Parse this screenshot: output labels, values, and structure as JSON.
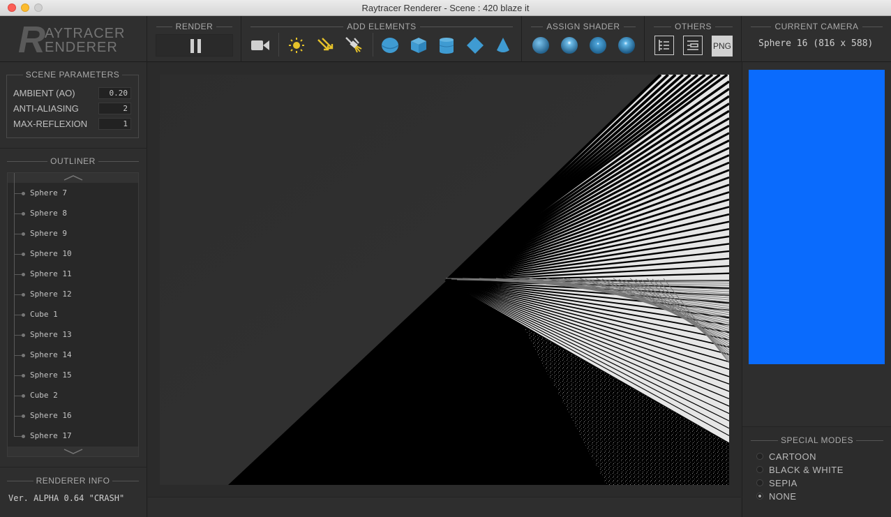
{
  "window": {
    "title": "Raytracer Renderer - Scene : 420 blaze it"
  },
  "logo": {
    "letter": "R",
    "line1": "AYTRACER",
    "line2": "ENDERER"
  },
  "toolbar": {
    "render_title": "RENDER",
    "add_title": "ADD ELEMENTS",
    "shader_title": "ASSIGN SHADER",
    "others_title": "OTHERS",
    "png_label": "PNG",
    "camera_title": "CURRENT CAMERA",
    "camera_value": "Sphere 16 (816 x 588)",
    "icons": [
      "pause-icon",
      "camera-icon",
      "point-light-icon",
      "directional-light-icon",
      "spot-light-icon",
      "sphere-icon",
      "cube-icon",
      "cylinder-icon",
      "plane-icon",
      "cone-icon",
      "shader-1-icon",
      "shader-2-icon",
      "shader-3-icon",
      "shader-4-icon",
      "list-icon",
      "properties-icon"
    ]
  },
  "scene": {
    "title": "SCENE PARAMETERS",
    "params": [
      {
        "label": "AMBIENT (AO)",
        "value": "0.20"
      },
      {
        "label": "ANTI-ALIASING",
        "value": "2"
      },
      {
        "label": "MAX-REFLEXION",
        "value": "1"
      }
    ]
  },
  "outliner": {
    "title": "OUTLINER",
    "items": [
      "Sphere 7",
      "Sphere 8",
      "Sphere 9",
      "Sphere 10",
      "Sphere 11",
      "Sphere 12",
      "Cube 1",
      "Sphere 13",
      "Sphere 14",
      "Sphere 15",
      "Cube 2",
      "Sphere 16",
      "Sphere 17"
    ]
  },
  "info": {
    "title": "RENDERER INFO",
    "version": "Ver. ALPHA 0.64 \"CRASH\""
  },
  "modes": {
    "title": "SPECIAL MODES",
    "options": [
      "CARTOON",
      "BLACK & WHITE",
      "SEPIA",
      "NONE"
    ],
    "selected": "NONE"
  },
  "colors": {
    "preview": "#0a6bfd",
    "icon_blue": "#3f9bd2",
    "icon_yellow": "#e5c22a"
  }
}
